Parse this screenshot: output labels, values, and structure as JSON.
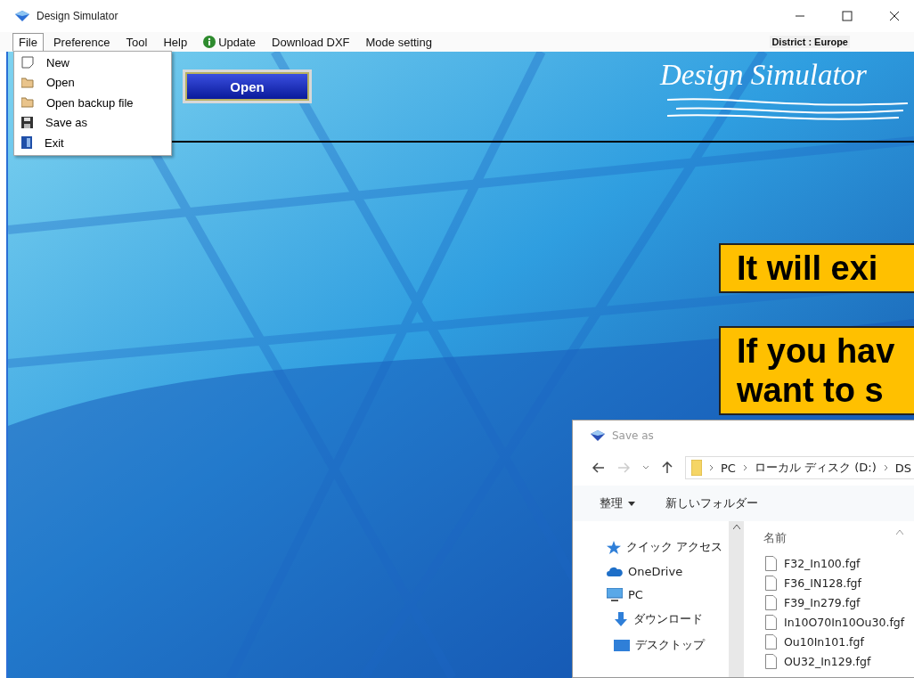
{
  "window": {
    "title": "Design Simulator"
  },
  "menu_bar": {
    "items": [
      {
        "label": "File",
        "kind": "text",
        "selected": true
      },
      {
        "label": "Preference",
        "kind": "text",
        "selected": false
      },
      {
        "label": "Tool",
        "kind": "text",
        "selected": false
      },
      {
        "label": "Help",
        "kind": "text",
        "selected": false
      },
      {
        "label": "Update",
        "kind": "info",
        "selected": false
      },
      {
        "label": "Download DXF",
        "kind": "text",
        "selected": false
      },
      {
        "label": "Mode setting",
        "kind": "text",
        "selected": false
      }
    ],
    "district": "District : Europe"
  },
  "file_menu": {
    "items": [
      {
        "label": "New",
        "kind": "page"
      },
      {
        "label": "Open",
        "kind": "folder"
      },
      {
        "label": "Open backup file",
        "kind": "folder"
      },
      {
        "label": "Save as",
        "kind": "disk"
      },
      {
        "label": "Exit",
        "kind": "door"
      }
    ]
  },
  "open_button": "Open",
  "logo": "Design Simulator",
  "callouts": [
    {
      "lines": [
        "It will exi"
      ]
    },
    {
      "lines": [
        "If you hav",
        "want to s"
      ]
    }
  ],
  "save_dialog": {
    "title": "Save as",
    "breadcrumb": [
      "PC",
      "ローカル ディスク (D:)",
      "DS"
    ],
    "toolbar": [
      {
        "label": "整理",
        "kind": "dropdown"
      },
      {
        "label": "新しいフォルダー",
        "kind": "plain"
      }
    ],
    "nav_items": [
      {
        "label": "クイック アクセス",
        "kind": "star"
      },
      {
        "label": "OneDrive",
        "kind": "cloud"
      },
      {
        "label": "PC",
        "kind": "pc"
      },
      {
        "label": "ダウンロード",
        "kind": "download"
      },
      {
        "label": "デスクトップ",
        "kind": "desktop"
      }
    ],
    "column": "名前",
    "files": [
      "F32_In100.fgf",
      "F36_IN128.fgf",
      "F39_In279.fgf",
      "In10O70In10Ou30.fgf",
      "Ou10In101.fgf",
      "OU32_In129.fgf"
    ]
  }
}
